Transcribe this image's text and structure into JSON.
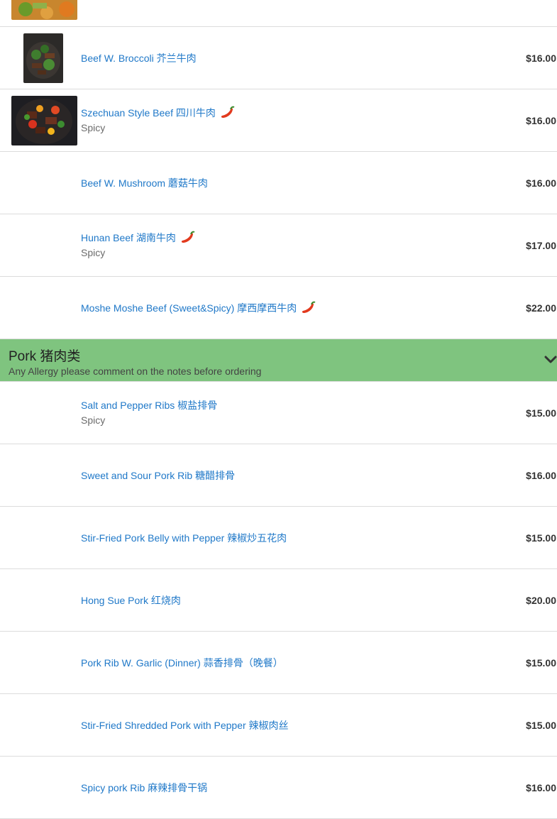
{
  "colors": {
    "category_bg": "#7fc47f",
    "link": "#1f78c8"
  },
  "top_item": {
    "name": "",
    "price": ""
  },
  "beef_items": [
    {
      "name": "Beef W. Broccoli 芥兰牛肉",
      "desc": "",
      "price": "$16.00",
      "spicy": false,
      "image": "beef-broccoli-photo"
    },
    {
      "name": "Szechuan Style Beef 四川牛肉",
      "desc": "Spicy",
      "price": "$16.00",
      "spicy": true,
      "image": "szechuan-beef-photo"
    },
    {
      "name": "Beef W. Mushroom 蘑菇牛肉",
      "desc": "",
      "price": "$16.00",
      "spicy": false,
      "image": ""
    },
    {
      "name": "Hunan Beef 湖南牛肉",
      "desc": "Spicy",
      "price": "$17.00",
      "spicy": true,
      "image": ""
    },
    {
      "name": "Moshe Moshe Beef (Sweet&Spicy) 摩西摩西牛肉",
      "desc": "",
      "price": "$22.00",
      "spicy": true,
      "image": ""
    }
  ],
  "category": {
    "title": "Pork 猪肉类",
    "subtitle": "Any Allergy please comment on the notes before ordering",
    "chevron_icon": "chevron-down-icon"
  },
  "pork_items": [
    {
      "name": "Salt and Pepper Ribs 椒盐排骨",
      "desc": "Spicy",
      "price": "$15.00",
      "spicy": false
    },
    {
      "name": "Sweet and Sour Pork Rib 糖醋排骨",
      "desc": "",
      "price": "$16.00",
      "spicy": false
    },
    {
      "name": "Stir-Fried Pork Belly with Pepper 辣椒炒五花肉",
      "desc": "",
      "price": "$15.00",
      "spicy": false
    },
    {
      "name": "Hong Sue Pork 红烧肉",
      "desc": "",
      "price": "$20.00",
      "spicy": false
    },
    {
      "name": "Pork Rib W. Garlic (Dinner) 蒜香排骨（晚餐）",
      "desc": "",
      "price": "$15.00",
      "spicy": false
    },
    {
      "name": "Stir-Fried Shredded Pork with Pepper 辣椒肉丝",
      "desc": "",
      "price": "$15.00",
      "spicy": false
    },
    {
      "name": "Spicy pork Rib 麻辣排骨干锅",
      "desc": "",
      "price": "$16.00",
      "spicy": false
    }
  ]
}
